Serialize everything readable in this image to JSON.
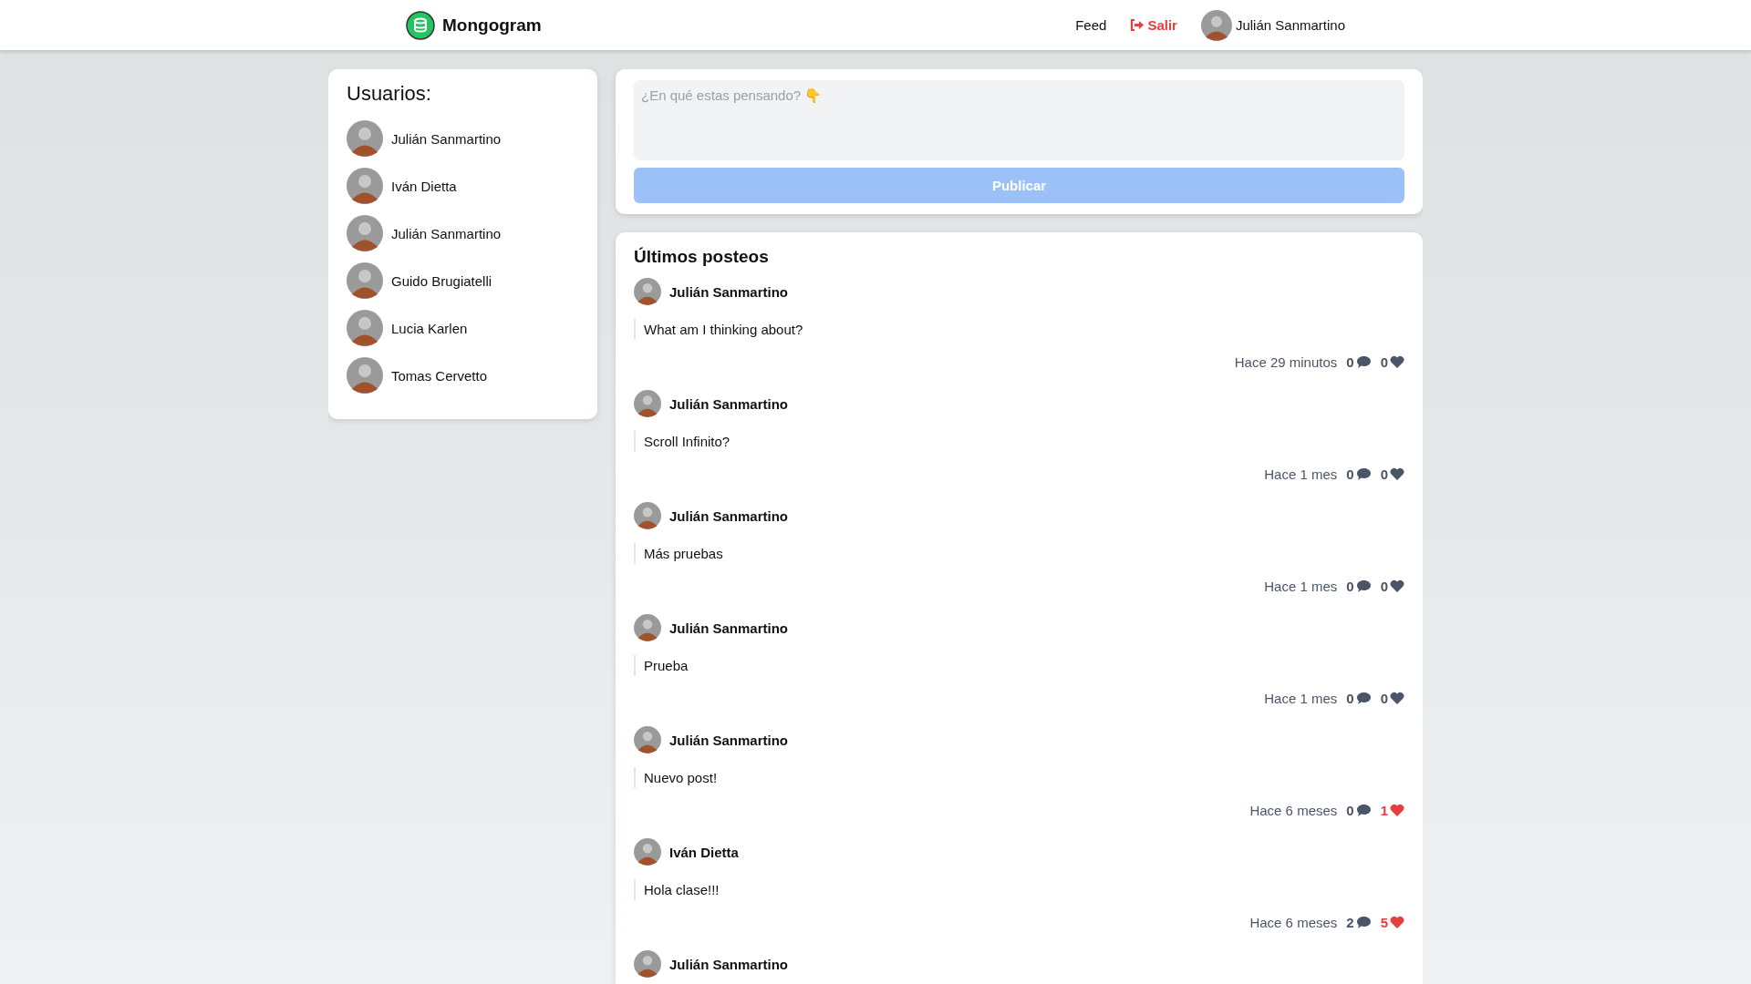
{
  "header": {
    "brand": "Mongogram",
    "nav": [
      {
        "label": "Feed",
        "kind": "link"
      },
      {
        "label": "Salir",
        "kind": "logout"
      }
    ],
    "user": "Julián Sanmartino"
  },
  "users": {
    "title": "Usuarios:",
    "items": [
      {
        "name": "Julián Sanmartino"
      },
      {
        "name": "Iván Dietta"
      },
      {
        "name": "Julián Sanmartino"
      },
      {
        "name": "Guido Brugiatelli"
      },
      {
        "name": "Lucia Karlen"
      },
      {
        "name": "Tomas Cervetto"
      }
    ]
  },
  "composer": {
    "placeholder": "¿En qué estas pensando? 👇",
    "button": "Publicar"
  },
  "feed": {
    "title": "Últimos posteos",
    "posts": [
      {
        "author": "Julián Sanmartino",
        "text": "What am I thinking about?",
        "time": "Hace 29 minutos",
        "comments": "0",
        "likes": "0",
        "liked": false
      },
      {
        "author": "Julián Sanmartino",
        "text": "Scroll Infinito?",
        "time": "Hace 1 mes",
        "comments": "0",
        "likes": "0",
        "liked": false
      },
      {
        "author": "Julián Sanmartino",
        "text": "Más pruebas",
        "time": "Hace 1 mes",
        "comments": "0",
        "likes": "0",
        "liked": false
      },
      {
        "author": "Julián Sanmartino",
        "text": "Prueba",
        "time": "Hace 1 mes",
        "comments": "0",
        "likes": "0",
        "liked": false
      },
      {
        "author": "Julián Sanmartino",
        "text": "Nuevo post!",
        "time": "Hace 6 meses",
        "comments": "0",
        "likes": "1",
        "liked": true
      },
      {
        "author": "Iván Dietta",
        "text": "Hola clase!!!",
        "time": "Hace 6 meses",
        "comments": "2",
        "likes": "5",
        "liked": true
      },
      {
        "author": "Julián Sanmartino"
      }
    ]
  }
}
